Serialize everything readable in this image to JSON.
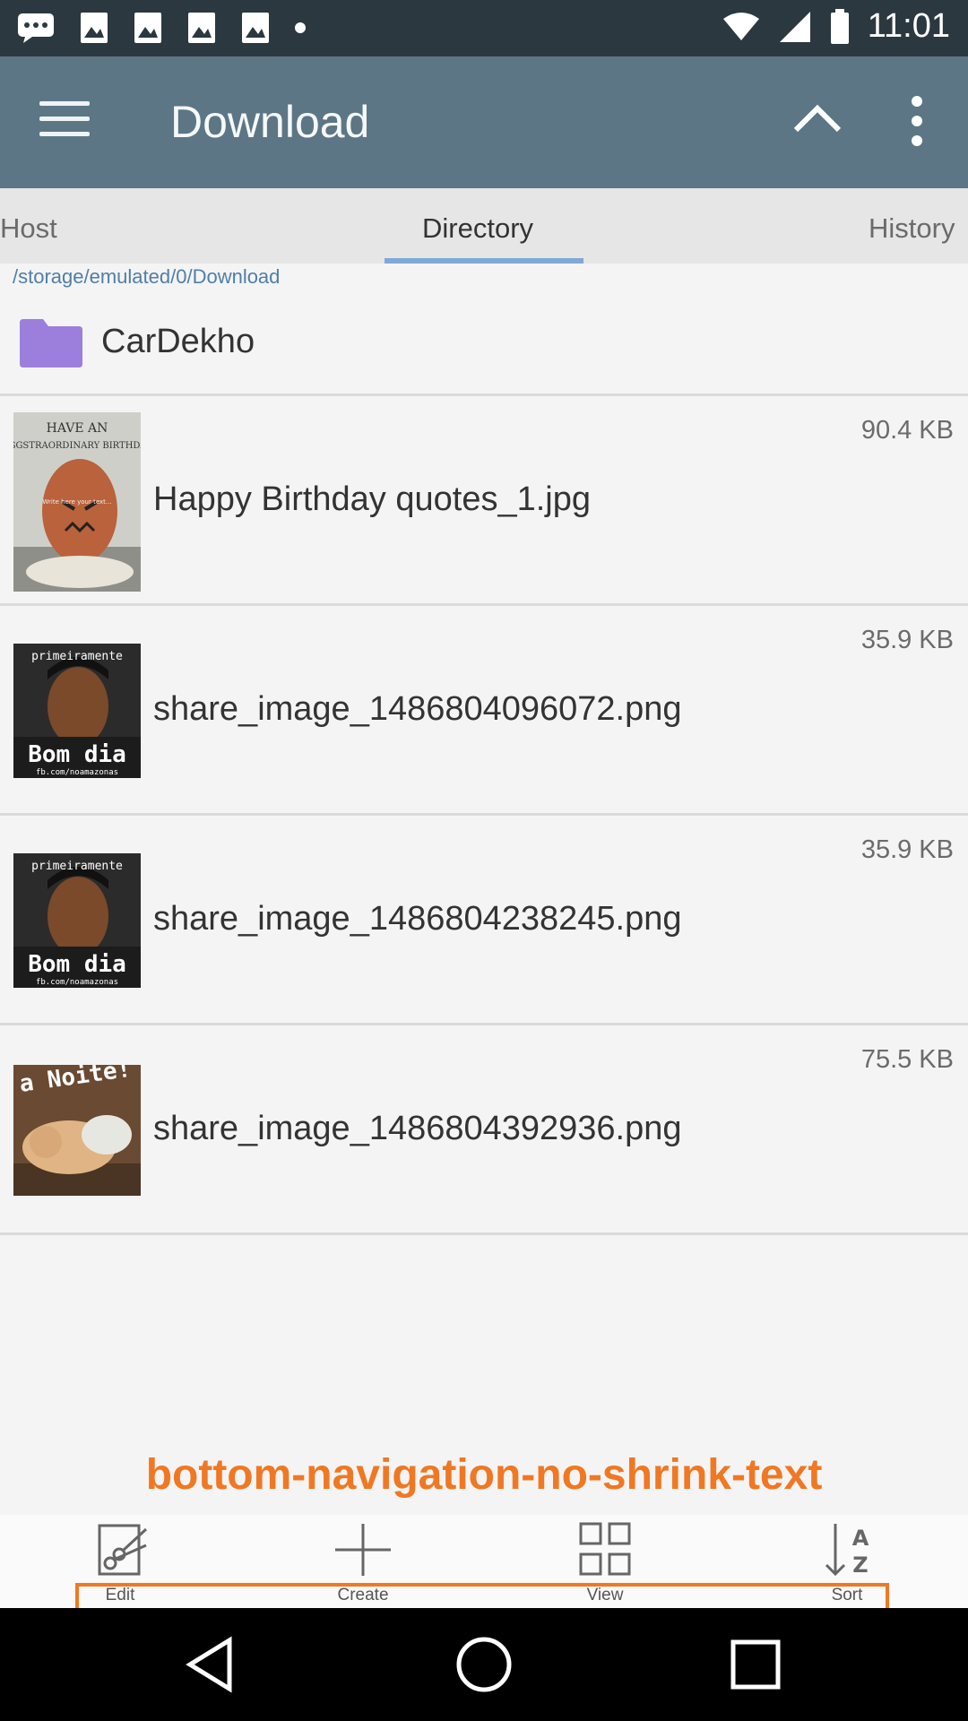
{
  "status_bar": {
    "time": "11:01",
    "left_icons": [
      "chat-icon",
      "image-icon",
      "image-icon",
      "image-icon",
      "image-icon",
      "dot-icon"
    ],
    "right_icons": [
      "wifi-icon",
      "signal-icon",
      "battery-icon"
    ]
  },
  "app_bar": {
    "title": "Download",
    "icons": [
      "menu-icon",
      "chevron-up-icon",
      "more-vert-icon"
    ]
  },
  "tabs": [
    {
      "label": "Host"
    },
    {
      "label": "Directory"
    },
    {
      "label": "History"
    }
  ],
  "active_tab": "Directory",
  "path": "/storage/emulated/0/Download",
  "folder": {
    "name": "CarDekho",
    "icon": "folder-icon"
  },
  "files": [
    {
      "name": "Happy Birthday quotes_1.jpg",
      "size": "90.4 KB",
      "thumb_text": [
        "HAVE AN",
        "EGGSTRAORDINARY BIRTHDAY",
        "Write here your text..."
      ]
    },
    {
      "name": "share_image_1486804096072.png",
      "size": "35.9 KB",
      "thumb_text": [
        "primeiramente",
        "Bom dia",
        "fb.com/noamazonas"
      ]
    },
    {
      "name": "share_image_1486804238245.png",
      "size": "35.9 KB",
      "thumb_text": [
        "primeiramente",
        "Bom dia",
        "fb.com/noamazonas"
      ]
    },
    {
      "name": "share_image_1486804392936.png",
      "size": "75.5 KB",
      "thumb_text": [
        "a Noite!"
      ]
    }
  ],
  "annotation": "bottom-navigation-no-shrink-text",
  "toolbar": [
    {
      "label": "Edit",
      "icon": "scissors-icon"
    },
    {
      "label": "Create",
      "icon": "plus-icon"
    },
    {
      "label": "View",
      "icon": "grid-icon"
    },
    {
      "label": "Sort",
      "icon": "sort-az-icon"
    }
  ],
  "nav_bar": [
    "back-icon",
    "home-icon",
    "recents-icon"
  ],
  "colors": {
    "app_bar": "#5c7685",
    "status_bar": "#2c3840",
    "tab_indicator": "#7fa9d6",
    "folder": "#9c7fdc",
    "annotation": "#f07823"
  }
}
